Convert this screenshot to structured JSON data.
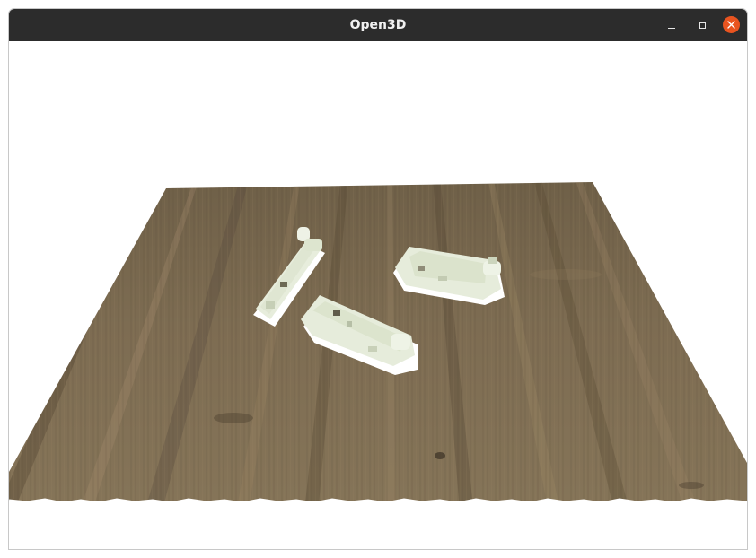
{
  "window": {
    "title": "Open3D",
    "controls": {
      "minimize": "minimize-icon",
      "maximize": "maximize-icon",
      "close": "close-icon"
    }
  },
  "scene": {
    "background": "#ffffff",
    "table_color": "#7a6a50",
    "object_color": "#e8eee0",
    "object_count": 3
  }
}
